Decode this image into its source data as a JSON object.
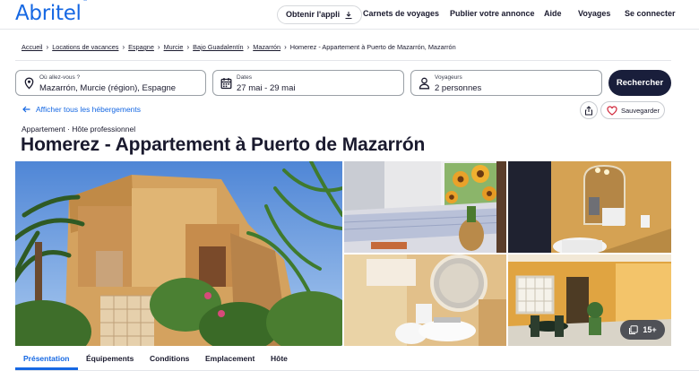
{
  "header": {
    "logo_text": "Abritel",
    "logo_mark": "®",
    "app_button": "Obtenir l'appli",
    "links": [
      "Carnets de voyages",
      "Publier votre annonce",
      "Aide",
      "Voyages",
      "Se connecter"
    ]
  },
  "breadcrumb": [
    "Accueil",
    "Locations de vacances",
    "Espagne",
    "Murcie",
    "Bajo Guadalentín",
    "Mazarrón",
    "Homerez - Appartement à Puerto de Mazarrón, Mazarrón"
  ],
  "search": {
    "destination_label": "Où allez-vous ?",
    "destination_value": "Mazarrón, Murcie (région), Espagne",
    "dates_label": "Dates",
    "dates_value": "27 mai - 29 mai",
    "travellers_label": "Voyageurs",
    "travellers_value": "2 personnes",
    "search_button": "Rechercher"
  },
  "actions": {
    "back_link": "Afficher tous les hébergements",
    "save_button": "Sauvegarder"
  },
  "listing": {
    "subtitle": "Appartement · Hôte professionnel",
    "title": "Homerez - Appartement à Puerto de Mazarrón",
    "photo_count": "15+"
  },
  "tabs": [
    "Présentation",
    "Équipements",
    "Conditions",
    "Emplacement",
    "Hôte"
  ],
  "active_tab": "Présentation",
  "colors": {
    "brand": "#1668e3",
    "search_button": "#191e3b",
    "text": "#1a1a2e"
  }
}
